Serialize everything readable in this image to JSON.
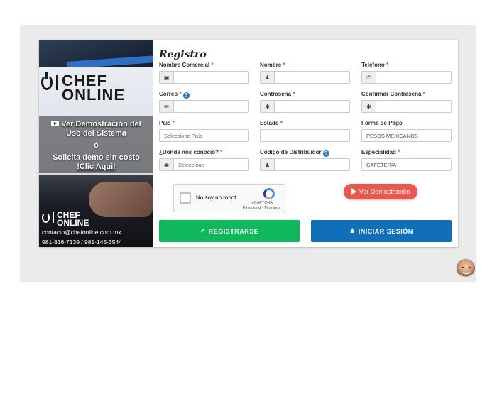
{
  "promo": {
    "logo_line1": "CHEF",
    "logo_line2": "ONLINE",
    "demo_line1": "Ver Demostración del",
    "demo_line2": "Uso del Sistema",
    "or_text": "ó",
    "solicit_text": "Solicita demo sin costo",
    "click_text": "!Clic Aqui!",
    "email": "contacto@chefonline.com.mx",
    "phones": "981-816-7139 / 981-145-3544"
  },
  "form": {
    "title": "Registro",
    "fields": {
      "nombre_comercial": {
        "label": "Nombre Comercial",
        "required": "*",
        "icon": "briefcase-icon",
        "value": ""
      },
      "nombre": {
        "label": "Nombre",
        "required": "*",
        "icon": "user-icon",
        "value": ""
      },
      "telefono": {
        "label": "Teléfono",
        "required": "*",
        "icon": "phone-icon",
        "value": ""
      },
      "correo": {
        "label": "Correo",
        "required": "*",
        "help": "?",
        "icon": "envelope-icon",
        "value": ""
      },
      "contrasena": {
        "label": "Contraseña",
        "required": "*",
        "icon": "lock-icon",
        "value": ""
      },
      "confirmar_contrasena": {
        "label": "Confirmar Contraseña",
        "required": "*",
        "icon": "lock-icon",
        "value": ""
      },
      "pais": {
        "label": "Pais",
        "required": "*",
        "value": "Seleccione País"
      },
      "estado": {
        "label": "Estado",
        "required": "*",
        "value": ""
      },
      "forma_pago": {
        "label": "Forma de Pago",
        "value": "PESOS MEXICANOS"
      },
      "como_conocio": {
        "label": "¿Donde nos conoció?",
        "required": "*",
        "icon": "globe-icon",
        "value": "Seleccione"
      },
      "codigo_distribuidor": {
        "label": "Código de Distribuidor",
        "help": "?",
        "icon": "user-icon",
        "value": ""
      },
      "especialidad": {
        "label": "Especialidad",
        "required": "*",
        "value": "CAFETERIA"
      }
    },
    "captcha": {
      "label": "No soy un robot",
      "brand": "reCAPTCHA",
      "links": "Privacidad - Términos"
    },
    "demo_button": "Ver Demostración",
    "register_button": "REGISTRARSE",
    "login_button": "INICIAR SESIÓN"
  },
  "colors": {
    "green": "#0fb85a",
    "blue": "#0f6fb8",
    "red": "#e9574e"
  }
}
